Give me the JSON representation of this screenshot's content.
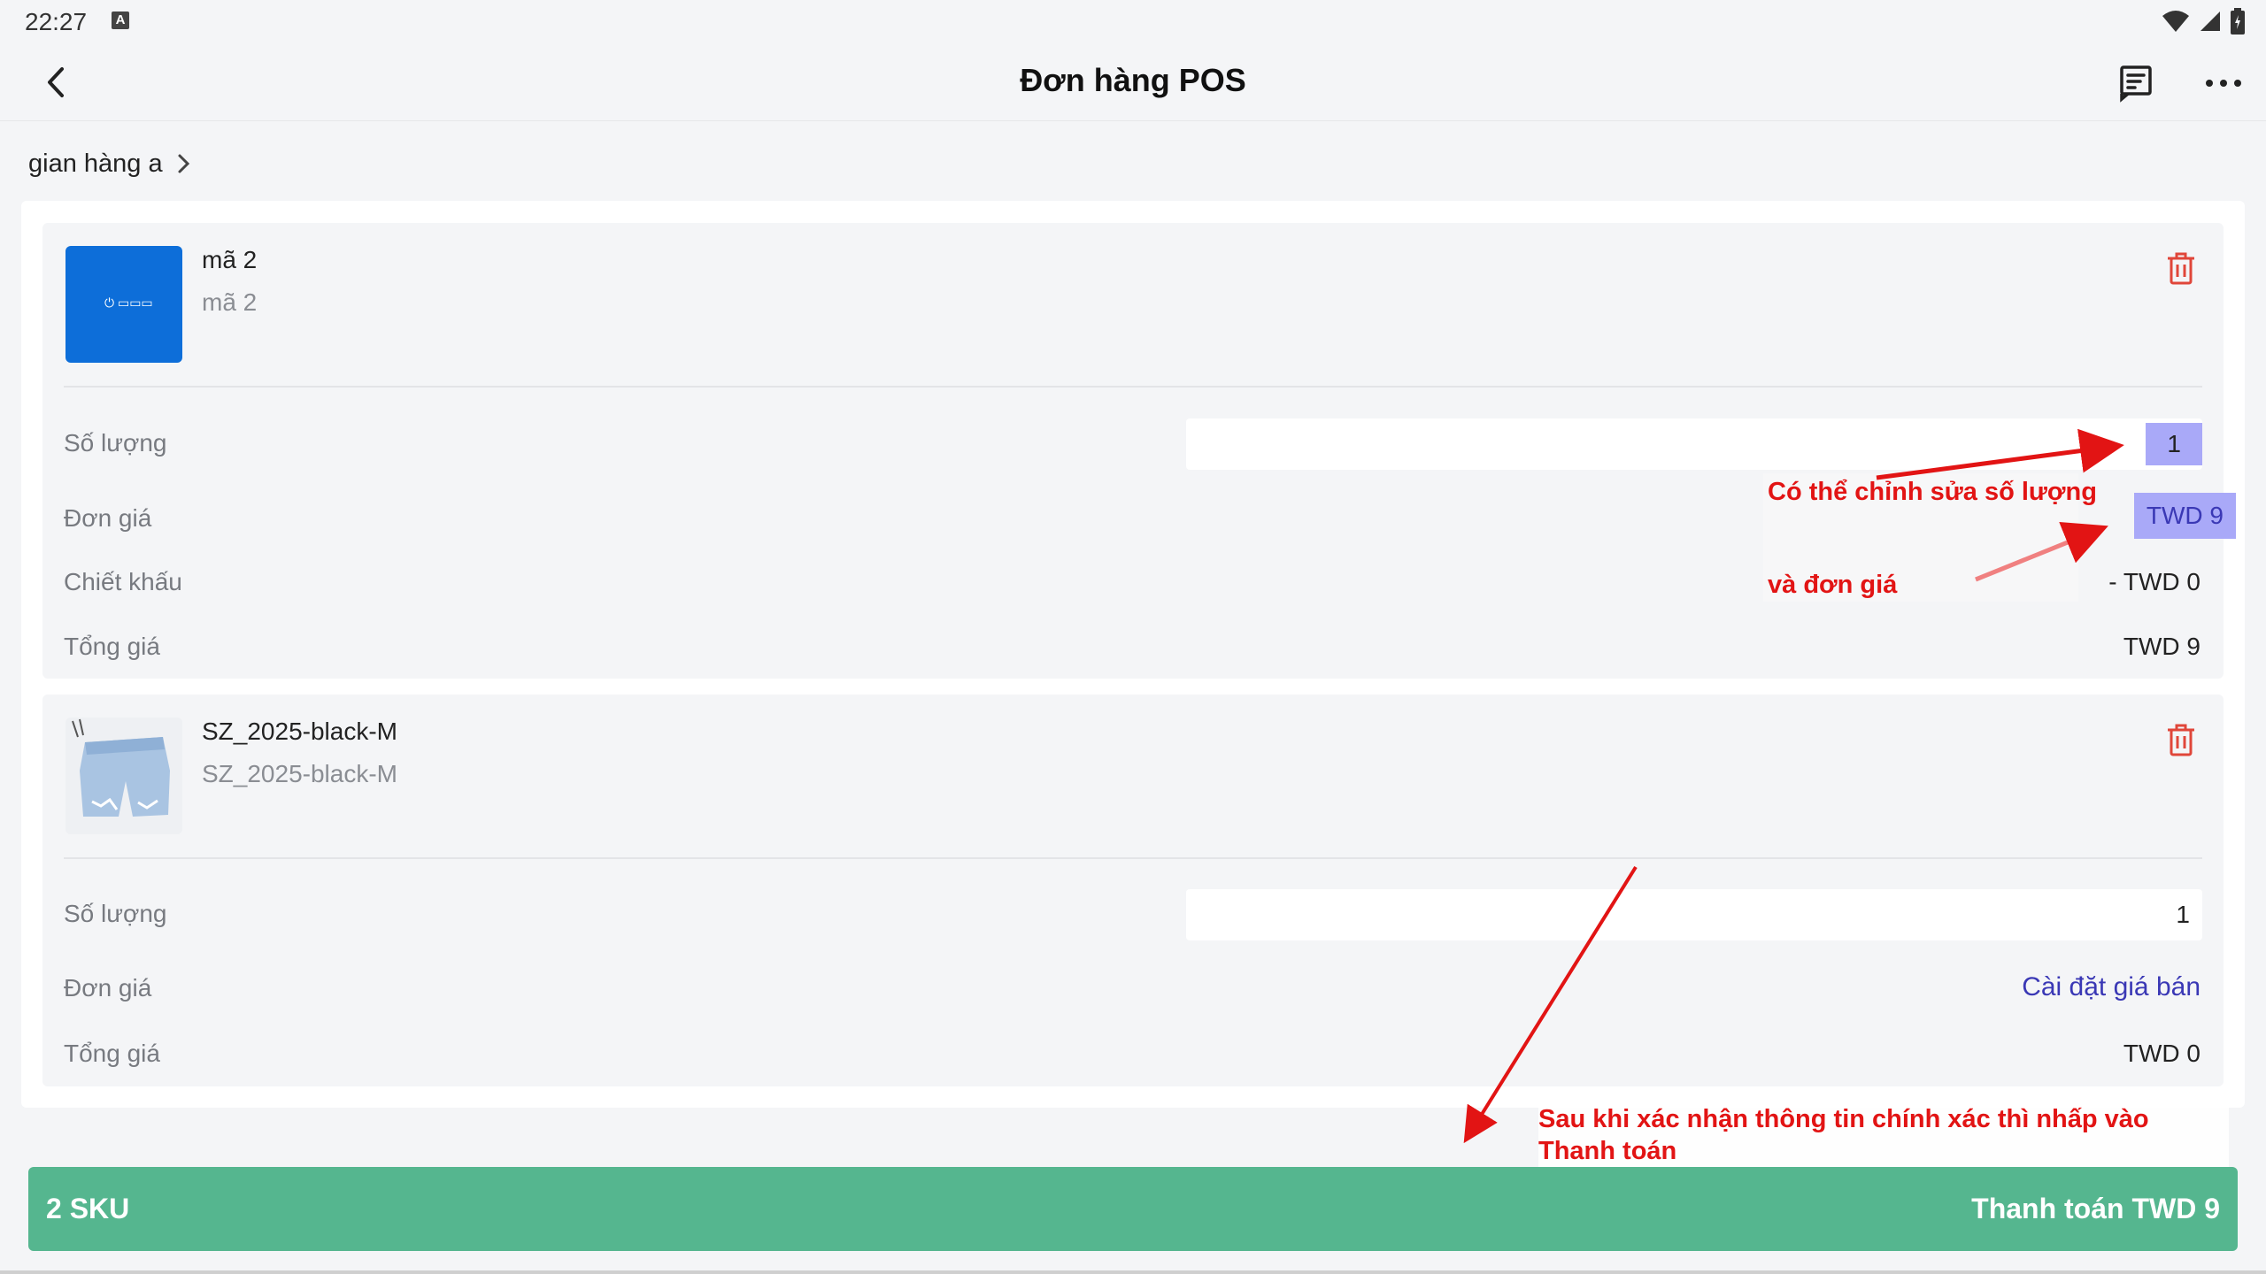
{
  "status_bar": {
    "time": "22:27",
    "notification_badge": "A"
  },
  "header": {
    "title": "Đơn hàng POS"
  },
  "store": {
    "name": "gian hàng a"
  },
  "items": [
    {
      "name": "mã 2",
      "code": "mã 2",
      "image": "blue-logo-thumbnail",
      "quantity_label": "Số lượng",
      "quantity": "1",
      "unit_price_label": "Đơn giá",
      "unit_price": "TWD 9",
      "discount_label": "Chiết khấu",
      "discount": "- TWD 0",
      "total_label": "Tổng giá",
      "total": "TWD 9"
    },
    {
      "name": "SZ_2025-black-M",
      "code": "SZ_2025-black-M",
      "image": "denim-shorts-photo",
      "quantity_label": "Số lượng",
      "quantity": "1",
      "unit_price_label": "Đơn giá",
      "unit_price_link": "Cài đặt giá bán",
      "total_label": "Tổng giá",
      "total": "TWD 0"
    }
  ],
  "annotations": {
    "edit_note_line1": "Có thể chỉnh sửa số lượng",
    "edit_note_line2": "và đơn giá",
    "pay_note": "Sau khi xác nhận thông tin chính xác thì nhấp vào Thanh toán"
  },
  "footer": {
    "sku_count": "2 SKU",
    "pay_button": "Thanh toán TWD 9"
  },
  "colors": {
    "accent_green": "#55b68f",
    "link_blue": "#3a38b5",
    "annotation_red": "#e21414",
    "delete_red": "#e0463a"
  },
  "icons": [
    "back-arrow-icon",
    "receipt-icon",
    "more-dots-icon",
    "chevron-right-icon",
    "trash-icon",
    "wifi-icon",
    "signal-icon",
    "battery-icon"
  ]
}
